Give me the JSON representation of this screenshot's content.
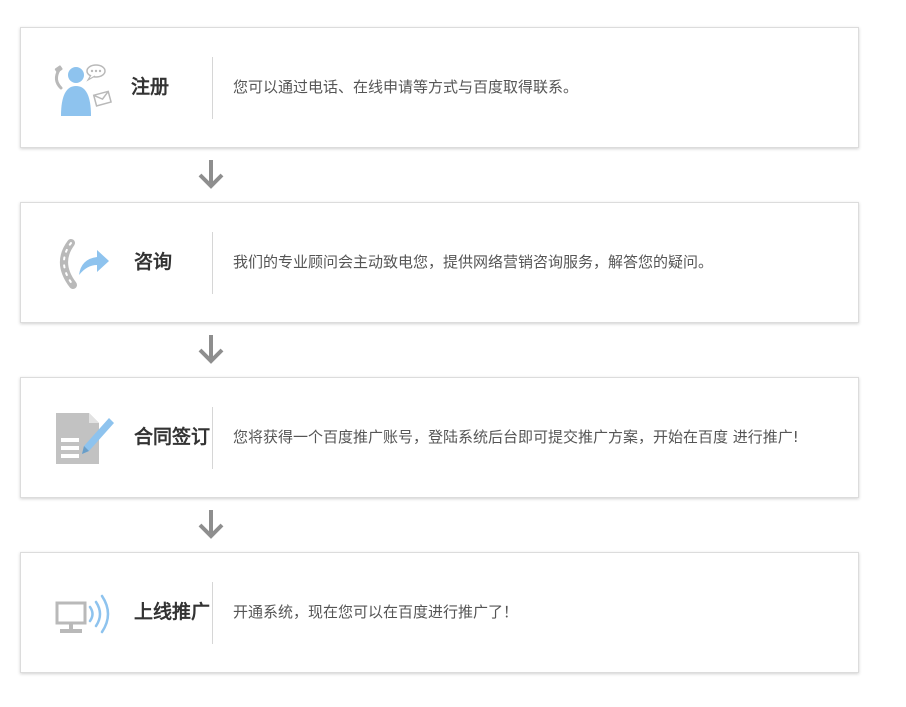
{
  "steps": [
    {
      "title": "注册",
      "description": "您可以通过电话、在线申请等方式与百度取得联系。",
      "icon": "user-contact-icon"
    },
    {
      "title": "咨询",
      "description": "我们的专业顾问会主动致电您，提供网络营销咨询服务，解答您的疑问。",
      "icon": "phone-callback-icon"
    },
    {
      "title": "合同签订",
      "description": "您将获得一个百度推广账号，登陆系统后台即可提交推广方案，开始在百度 进行推广!",
      "icon": "contract-sign-icon"
    },
    {
      "title": "上线推广",
      "description": "开通系统，现在您可以在百度进行推广了！",
      "icon": "computer-broadcast-icon"
    }
  ],
  "colors": {
    "accent_blue": "#8ec3ee",
    "icon_gray": "#b9b9b9",
    "arrow_gray": "#8e8e8e",
    "title_text": "#333333",
    "desc_text": "#555555"
  }
}
